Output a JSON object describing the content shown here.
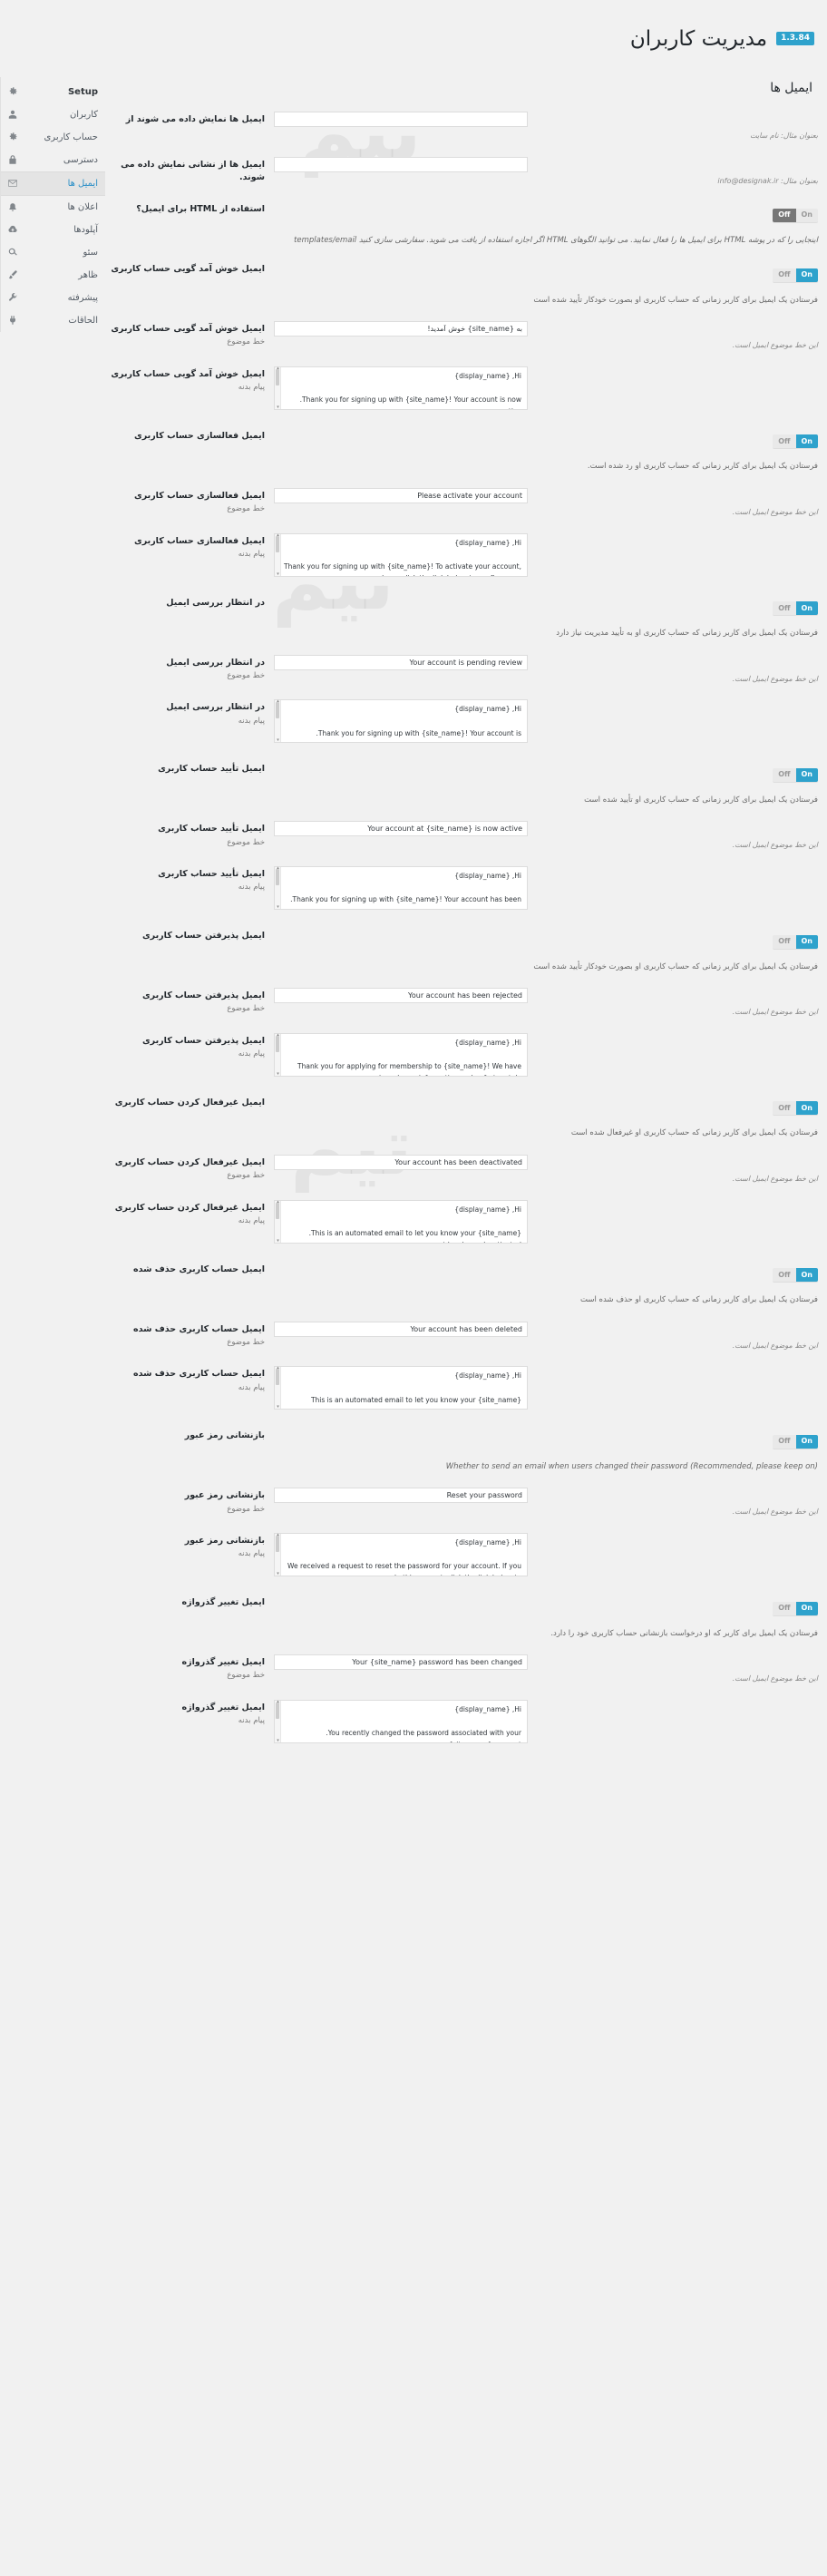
{
  "header": {
    "title": "مدیریت کاربران",
    "version": "1.3.84"
  },
  "sidebar": {
    "items": [
      {
        "label": "Setup",
        "icon": "gear-icon",
        "active": false,
        "bold": true
      },
      {
        "label": "کاربران",
        "icon": "users-icon",
        "active": false
      },
      {
        "label": "حساب کاربری",
        "icon": "gear-icon",
        "active": false
      },
      {
        "label": "دسترسی",
        "icon": "lock-icon",
        "active": false
      },
      {
        "label": "ایمیل ها",
        "icon": "envelope-icon",
        "active": true
      },
      {
        "label": "اعلان ها",
        "icon": "bell-icon",
        "active": false
      },
      {
        "label": "آپلودها",
        "icon": "cloud-upload-icon",
        "active": false
      },
      {
        "label": "سئو",
        "icon": "search-icon",
        "active": false
      },
      {
        "label": "ظاهر",
        "icon": "brush-icon",
        "active": false
      },
      {
        "label": "پیشرفته",
        "icon": "wrench-icon",
        "active": false
      },
      {
        "label": "الحاقات",
        "icon": "plug-icon",
        "active": false
      }
    ]
  },
  "main": {
    "section_title": "ایمیل ها",
    "from_name": {
      "label": "ایمیل ها نمایش داده می شوند از",
      "value": "",
      "hint": "بعنوان مثال: نام سایت"
    },
    "from_address": {
      "label": "ایمیل ها از نشانی نمایش داده می شوند.",
      "value": "",
      "hint": "بعنوان مثال: info@designak.ir"
    },
    "html_emails": {
      "label": "استفاده از HTML برای ایمیل؟",
      "toggle_on": "On",
      "toggle_off": "Off",
      "state": "off",
      "desc": "اینجایی را که در پوشه HTML برای ایمیل ها را فعال نمایید. می توانید الگوهای HTML اگر اجازه استفاده از یافت می شوید. سفارشی سازی کنید templates/email"
    },
    "toggle_labels": {
      "on": "On",
      "off": "Off"
    },
    "field_labels": {
      "subject_line": "خط موضوع",
      "body_line": "پیام بدنه",
      "subject_hint": "این خط موضوع ایمیل است.",
      "subject_hint_alt": "خط موضوع ایمیل است."
    },
    "blocks": [
      {
        "id": "welcome",
        "title": "ایمیل خوش آمد گویی حساب کاربری",
        "toggle_state": "on",
        "desc": "فرستادن یک ایمیل برای کاربر زمانی که حساب کاربری او بصورت خودکار تأیید شده است",
        "subject_label": "ایمیل خوش آمد گویی حساب کاربری",
        "subject_sub": "خط موضوع",
        "subject_value": "به {site_name} خوش آمدید!",
        "subject_value_rtl": true,
        "subject_hint": "این خط موضوع ایمیل است.",
        "body_label": "ایمیل خوش آمد گویی حساب کاربری",
        "body_sub": "پیام بدنه",
        "body_value": "{display_name} ,Hi\n\n.Thank you for signing up with {site_name}! Your account is now active\n\n:To login please visit the following url"
      },
      {
        "id": "activation",
        "title": "ایمیل فعالسازی حساب کاربری",
        "toggle_state": "on",
        "desc": "فرستادن یک ایمیل برای کاربر زمانی که حساب کاربری او رد شده است.",
        "subject_label": "ایمیل فعالسازی حساب کاربری",
        "subject_sub": "خط موضوع",
        "subject_value": "Please activate your account",
        "subject_value_rtl": false,
        "subject_hint": "این خط موضوع ایمیل است.",
        "body_label": "ایمیل فعالسازی حساب کاربری",
        "body_sub": "پیام بدنه",
        "body_value": "{display_name} ,Hi\n\nThank you for signing up with {site_name}! To activate your account, please click the link below to confirm your\n.email address\n\n{account_activation_link}"
      },
      {
        "id": "pending-review",
        "title": "در انتظار بررسی ایمیل",
        "toggle_state": "on",
        "desc": "فرستادن یک ایمیل برای کاربر زمانی که حساب کاربری او به تأیید مدیریت نیاز دارد",
        "subject_label": "در انتظار بررسی ایمیل",
        "subject_sub": "خط موضوع",
        "subject_value": "Your account is pending review",
        "subject_value_rtl": false,
        "subject_hint": "این خط موضوع ایمیل است.",
        "body_label": "در انتظار بررسی ایمیل",
        "body_sub": "پیام بدنه",
        "body_value": "{display_name} ,Hi\n\n.Thank you for signing up with {site_name}! Your account is currently being reviewed by a member of our team\n\n.Please allow us some time to process your request"
      },
      {
        "id": "approved",
        "title": "ایمیل تأیید حساب کاربری",
        "toggle_state": "on",
        "desc": "فرستادن یک ایمیل برای کاربر زمانی که حساب کاربری او تأیید شده است",
        "subject_label": "ایمیل تأیید حساب کاربری",
        "subject_sub": "خط موضوع",
        "subject_value": "Your account at {site_name} is now active",
        "subject_value_rtl": false,
        "subject_hint": "این خط موضوع ایمیل است.",
        "body_label": "ایمیل تأیید حساب کاربری",
        "body_sub": "پیام بدنه",
        "body_value": "{display_name} ,Hi\n\n.Thank you for signing up with {site_name}! Your account has been approved and is now active\n\n:To login please visit the following url"
      },
      {
        "id": "rejected",
        "title": "ایمیل پذیرفتن حساب کاربری",
        "toggle_state": "on",
        "desc": "فرستادن یک ایمیل برای کاربر زمانی که حساب کاربری او بصورت خودکار تأیید شده است",
        "subject_label": "ایمیل پذیرفتن حساب کاربری",
        "subject_sub": "خط موضوع",
        "subject_value": "Your account has been rejected",
        "subject_value_rtl": false,
        "subject_hint": "این خط موضوع ایمیل است.",
        "body_label": "ایمیل پذیرفتن حساب کاربری",
        "body_sub": "پیام بدنه",
        "body_value": "{display_name} ,Hi\n\nThank you for applying for membership to {site_name}! We have reviewed your information and unfortunately\n.we are unable to accept you as a member at this moment\n\n.Please feel free to apply again at a future date"
      },
      {
        "id": "deactivated",
        "title": "ایمیل غیرفعال کردن حساب کاربری",
        "toggle_state": "on",
        "desc": "فرستادن یک ایمیل برای کاربر زمانی که حساب کاربری او غیرفعال شده است",
        "subject_label": "ایمیل غیرفعال کردن حساب کاربری",
        "subject_sub": "خط موضوع",
        "subject_value": "Your account has been deactivated",
        "subject_value_rtl": false,
        "subject_hint": "این خط موضوع ایمیل است.",
        "body_label": "ایمیل غیرفعال کردن حساب کاربری",
        "body_sub": "پیام بدنه",
        "body_value": "{display_name} ,Hi\n\n.This is an automated email to let you know your {site_name} account has been deactivated\n\n{If you would like your account to be reactivated please contact us at {admin_email"
      },
      {
        "id": "deleted",
        "title": "ایمیل حساب کاربری حذف شده",
        "toggle_state": "on",
        "desc": "فرستادن یک ایمیل برای کاربر زمانی که حساب کاربری او حذف شده است",
        "subject_label": "ایمیل حساب کاربری حذف شده",
        "subject_sub": "خط موضوع",
        "subject_value": "Your account has been deleted",
        "subject_value_rtl": false,
        "subject_hint": "این خط موضوع ایمیل است.",
        "body_label": "ایمیل حساب کاربری حذف شده",
        "body_sub": "پیام بدنه",
        "body_value": "{display_name} ,Hi\n\nThis is an automated email to let you know your {site_name} account has been deleted. All of your personal\n.information has been permanently deleted and you will no longer be able to login to {site_name}\n\n{If your account has been deleted by accident please contact us at {admin_email"
      },
      {
        "id": "password-reset",
        "title": "بازنشانی رمز عبور",
        "toggle_state": "on",
        "desc": "Whether to send an email when users changed their password (Recommended, please keep on)",
        "desc_italic": true,
        "subject_label": "بازنشانی رمز عبور",
        "subject_sub": "خط موضوع",
        "subject_value": "Reset your password",
        "subject_value_rtl": false,
        "subject_hint": "این خط موضوع ایمیل است.",
        "body_label": "بازنشانی رمز عبور",
        "body_sub": "پیام بدنه",
        "body_value": "{display_name} ,Hi\n\nWe received a request to reset the password for your account. If you made this request, click the link below to\n:change your password\n\n{password_reset_link}"
      },
      {
        "id": "password-changed",
        "title": "ایمیل تغییر گذرواژه",
        "toggle_state": "on",
        "desc": "فرستادن یک ایمیل برای کاربر که او درخواست بازنشانی حساب کاربری خود را دارد.",
        "subject_label": "ایمیل تغییر گذرواژه",
        "subject_sub": "خط موضوع",
        "subject_value": "Your {site_name} password has been changed",
        "subject_value_rtl": false,
        "subject_hint": "این خط موضوع ایمیل است.",
        "body_label": "ایمیل تغییر گذرواژه",
        "body_sub": "پیام بدنه",
        "body_value": "{display_name} ,Hi\n\n.You recently changed the password associated with your {site_name} account\n\nIf you did not make this change and believe your {site_name} account has been compromised, please contact us\n{at the following email address: {admin_email"
      }
    ]
  },
  "colors": {
    "accent": "#2ea2cc",
    "link": "#0073aa",
    "bg": "#f1f1f1",
    "text": "#23282d"
  }
}
